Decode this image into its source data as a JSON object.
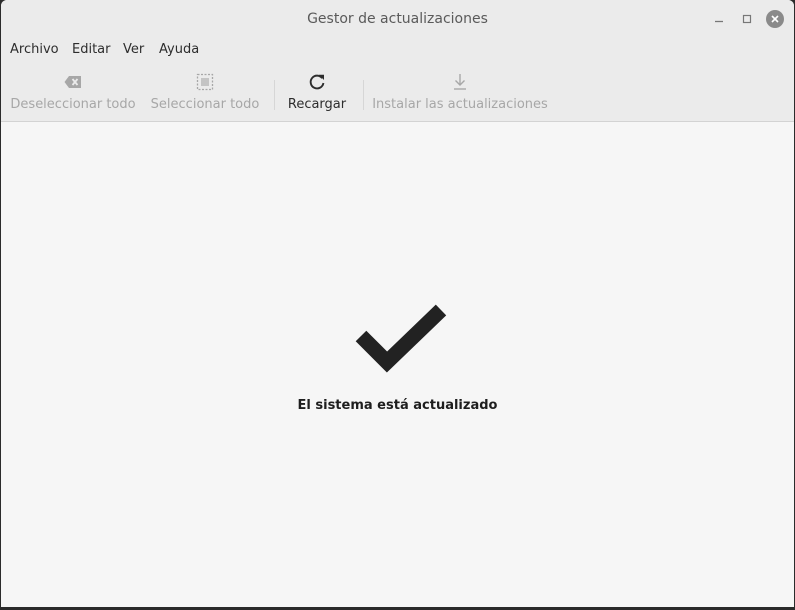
{
  "window": {
    "title": "Gestor de actualizaciones"
  },
  "menubar": {
    "items": [
      {
        "label": "Archivo"
      },
      {
        "label": "Editar"
      },
      {
        "label": "Ver"
      },
      {
        "label": "Ayuda"
      }
    ]
  },
  "toolbar": {
    "deselect_all": {
      "label": "Deseleccionar todo",
      "icon": "clear-icon",
      "enabled": false
    },
    "select_all": {
      "label": "Seleccionar todo",
      "icon": "select-all-icon",
      "enabled": false
    },
    "reload": {
      "label": "Recargar",
      "icon": "refresh-icon",
      "enabled": true
    },
    "install": {
      "label": "Instalar las actualizaciones",
      "icon": "download-icon",
      "enabled": false
    }
  },
  "main": {
    "status_icon": "checkmark-icon",
    "status_text": "El sistema está actualizado"
  },
  "colors": {
    "window_bg": "#f6f6f6",
    "chrome_bg": "#ebebeb",
    "disabled_text": "#a7a7a7",
    "text": "#2d2d2d",
    "check": "#222222"
  }
}
